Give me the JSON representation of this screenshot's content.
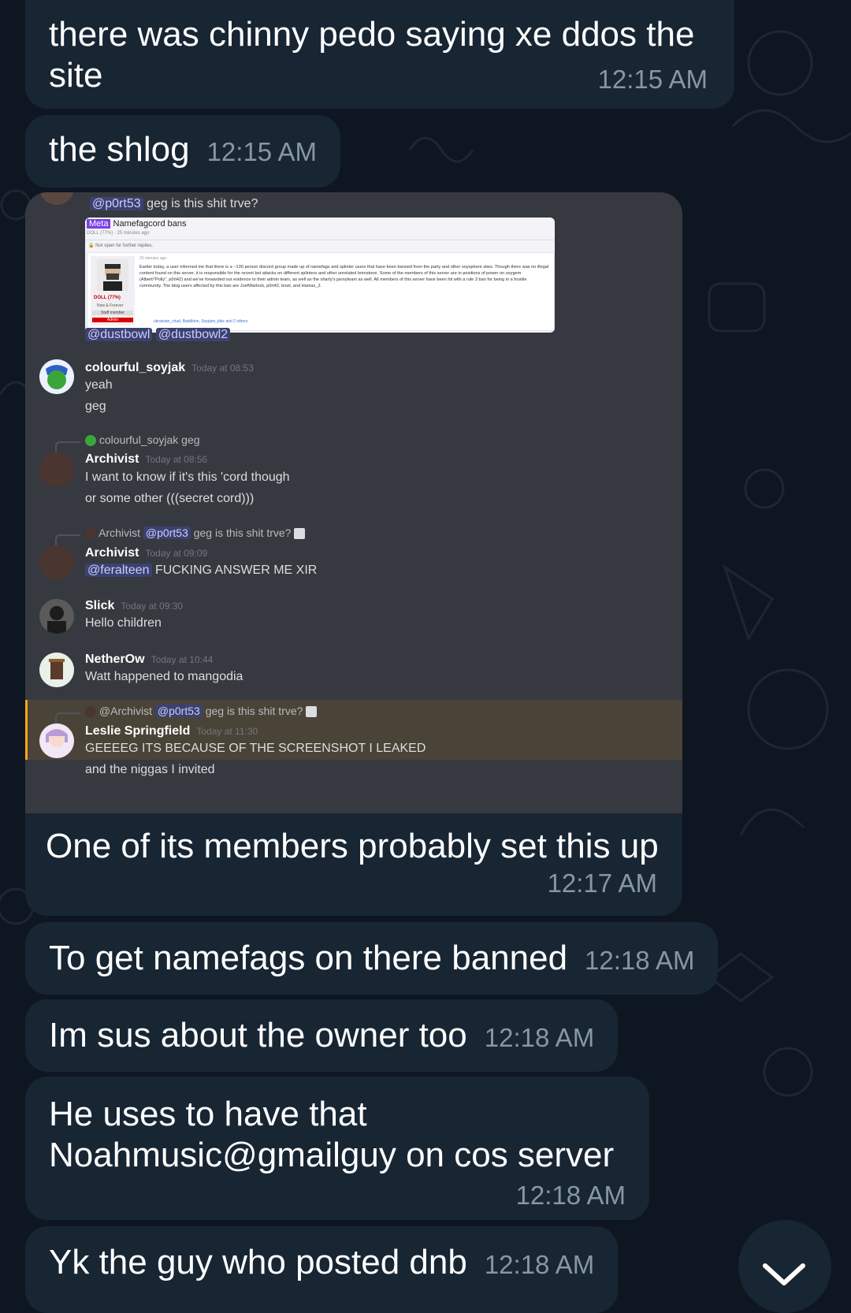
{
  "messages": [
    {
      "text": "there was chinny pedo saying xe ddos the site",
      "time": "12:15 AM"
    },
    {
      "text": "the shlog",
      "time": "12:15 AM"
    },
    {
      "text": "One of its members probably set this up",
      "time": "12:17 AM"
    },
    {
      "text": "To get namefags on there banned",
      "time": "12:18 AM"
    },
    {
      "text": "Im sus about the owner too",
      "time": "12:18 AM"
    },
    {
      "text": "He uses to have that Noahmusic@gmailguy on cos server",
      "time": "12:18 AM"
    },
    {
      "text": "Yk the guy who posted dnb",
      "time": "12:18 AM"
    }
  ],
  "embed": {
    "top_mention": "@p0rt53",
    "top_text": "geg is this shit trve?",
    "post": {
      "badge": "Meta",
      "title": "Namefagcord bans",
      "meta_line": "DOLL (77%) · 25 minutes ago",
      "notice": "Not open for further replies.",
      "time_small": "25 minutes ago",
      "user_name": "DOLL (77%)",
      "user_sub": "Now & Forever",
      "staff": "Staff member",
      "admin": "Admin",
      "body": "Earlier today, a user informed me that there is a ~130 person discord group made up of namefags and splinter users that have been banned from the party and other soysphere sites. Though there was no illegal content found on this server, it is responsible for the recent bot attacks on different splinters and other unrelated brimstone. Some of the members of this server are in positions of power on soygem (Albert/\"Polly\", p0rt42) and we've forwarded our evidence to their admin team, as well as the sharty's jannyteam as well. All members of this server have been hit with a rule 3 ban for being in a hostile community. The blog users affected by this ban are JoelWarlock, p0rt42, bowl, and Hamas_2.",
      "footer": "ukrainian_chud, Baddkinn, Soyjaim_bike and 2 others"
    },
    "mentions": [
      "@dustbowl",
      "@dustbowl2"
    ],
    "msgs": [
      {
        "name": "colourful_soyjak",
        "time": "Today at 08:53",
        "lines": [
          "yeah",
          "geg"
        ]
      },
      {
        "reply_name": "colourful_soyjak",
        "reply_text": "geg",
        "name": "Archivist",
        "time": "Today at 08:56",
        "lines": [
          "I want to know if it's this 'cord though",
          "or some other (((secret cord)))"
        ]
      },
      {
        "reply_name": "Archivist",
        "reply_mention": "@p0rt53",
        "reply_text": "geg is this shit trve?",
        "name": "Archivist",
        "time": "Today at 09:09",
        "mention": "@feralteen",
        "lines": [
          "FUCKING ANSWER ME XIR"
        ]
      },
      {
        "name": "Slick",
        "time": "Today at 09:30",
        "lines": [
          "Hello children"
        ]
      },
      {
        "name": "NetherOw",
        "time": "Today at 10:44",
        "lines": [
          "Watt happened to mangodia"
        ]
      },
      {
        "reply_name": "@Archivist",
        "reply_mention": "@p0rt53",
        "reply_text": "geg is this shit trve?",
        "name": "Leslie Springfield",
        "time": "Today at 11:30",
        "lines": [
          "GEEEEG ITS BECAUSE OF THE SCREENSHOT I LEAKED",
          "and the niggas I invited"
        ]
      }
    ]
  },
  "colors": {
    "background": "#0e1621",
    "bubble": "#182533",
    "time": "#8796a6",
    "mention_bg": "#3c4270"
  },
  "scroll_button_icon": "chevron-down-icon"
}
